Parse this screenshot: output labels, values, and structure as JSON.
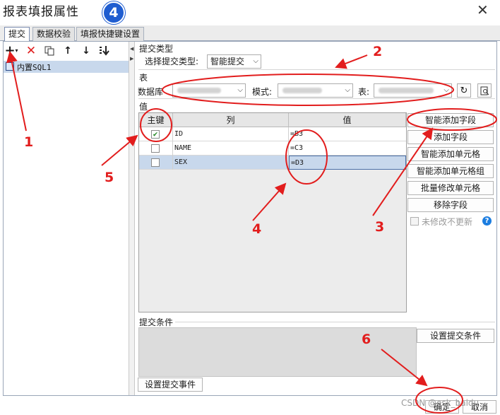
{
  "window": {
    "title": "报表填报属性",
    "close_glyph": "✕"
  },
  "tabs": [
    {
      "label": "提交",
      "active": true
    },
    {
      "label": "数据校验",
      "active": false
    },
    {
      "label": "填报快捷键设置",
      "active": false
    }
  ],
  "toolbar": {
    "icons": [
      "add-icon",
      "delete-icon",
      "copy-icon",
      "move-up-icon",
      "move-down-icon",
      "move-bottom-icon"
    ]
  },
  "tree": {
    "items": [
      {
        "label": "内置SQL1",
        "selected": true
      }
    ]
  },
  "submit_type": {
    "section": "提交类型",
    "label": "选择提交类型:",
    "value": "智能提交"
  },
  "table_section": {
    "section": "表",
    "db_label": "数据库",
    "schema_label": "模式:",
    "table_label": "表:"
  },
  "values_section": {
    "section": "值",
    "columns": [
      "主键",
      "列",
      "值"
    ],
    "rows": [
      {
        "key": true,
        "column": "ID",
        "value": "=B3",
        "selected": false
      },
      {
        "key": false,
        "column": "NAME",
        "value": "=C3",
        "selected": false
      },
      {
        "key": false,
        "column": "SEX",
        "value": "=D3",
        "selected": true
      }
    ]
  },
  "side_buttons": [
    {
      "label": "智能添加字段"
    },
    {
      "label": "添加字段"
    },
    {
      "label": "智能添加单元格"
    },
    {
      "label": "智能添加单元格组"
    },
    {
      "label": "批量修改单元格"
    },
    {
      "label": "移除字段"
    }
  ],
  "unchanged_checkbox": {
    "label": "未修改不更新",
    "checked": false
  },
  "conditions": {
    "section": "提交条件",
    "set_button": "设置提交条件"
  },
  "events": {
    "button": "设置提交事件"
  },
  "footer": {
    "ok": "确定",
    "cancel": "取消"
  },
  "annotations": {
    "badge": "4",
    "n1": "1",
    "n2": "2",
    "n3": "3",
    "n4": "4",
    "n5": "5",
    "n6": "6"
  },
  "watermark": "CSDN @esk_baidu",
  "colors": {
    "annotation_red": "#e21d1d",
    "badge_blue": "#1f5dd0",
    "selection": "#c8d8ec"
  }
}
